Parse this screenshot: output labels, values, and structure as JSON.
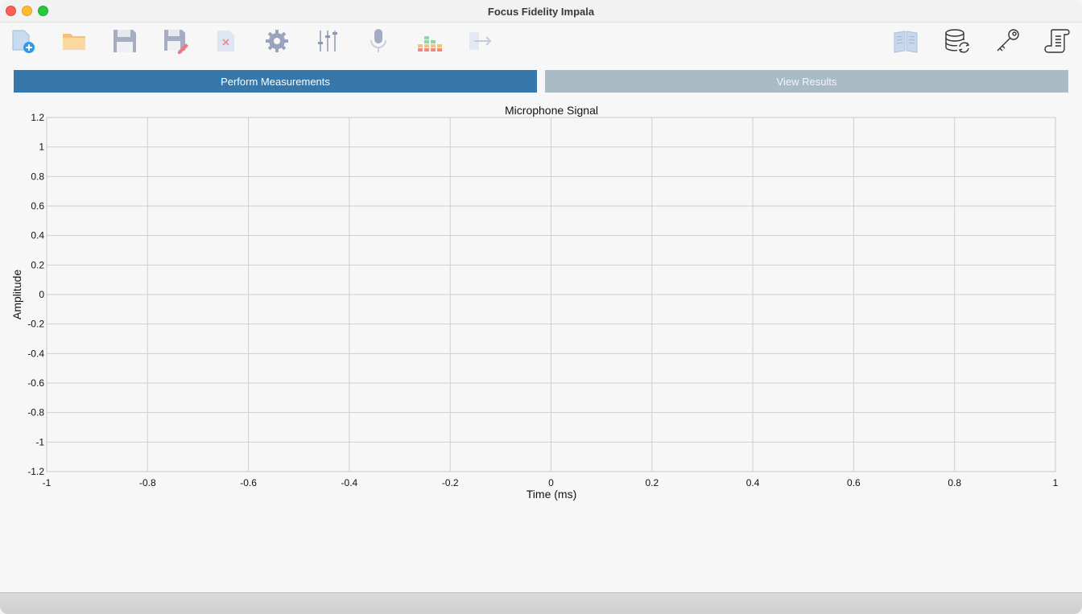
{
  "window": {
    "title": "Focus Fidelity Impala"
  },
  "toolbar": {
    "left_icons": [
      "new-project-icon",
      "open-folder-icon",
      "save-icon",
      "save-as-icon",
      "close-document-icon",
      "settings-gear-icon",
      "mixer-sliders-icon",
      "microphone-icon",
      "level-meter-icon",
      "export-arrow-icon"
    ],
    "right_icons": [
      "manual-book-icon",
      "database-sync-icon",
      "license-key-icon",
      "log-scroll-icon"
    ]
  },
  "tabs": {
    "perform": "Perform Measurements",
    "results": "View Results"
  },
  "colors": {
    "tab_active": "#3777aa",
    "tab_inactive": "#a9bcc6",
    "grid": "#cfcfcf"
  },
  "chart_data": {
    "type": "line",
    "title": "Microphone Signal",
    "xlabel": "Time (ms)",
    "ylabel": "Amplitude",
    "xlim": [
      -1,
      1
    ],
    "ylim": [
      -1.2,
      1.2
    ],
    "x_ticks": [
      "-1",
      "-0.8",
      "-0.6",
      "-0.4",
      "-0.2",
      "0",
      "0.2",
      "0.4",
      "0.6",
      "0.8",
      "1"
    ],
    "y_ticks": [
      "1.2",
      "1",
      "0.8",
      "0.6",
      "0.4",
      "0.2",
      "0",
      "-0.2",
      "-0.4",
      "-0.6",
      "-0.8",
      "-1",
      "-1.2"
    ],
    "grid": true,
    "series": []
  }
}
